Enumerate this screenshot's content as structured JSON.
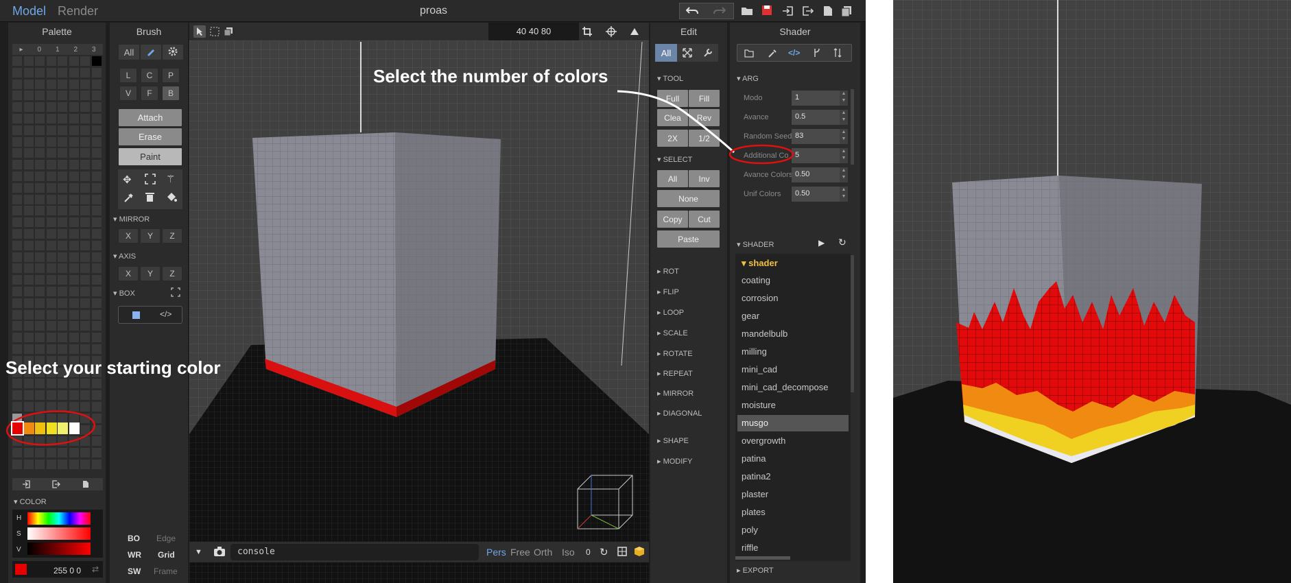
{
  "topbar": {
    "tabs": [
      "Model",
      "Render"
    ],
    "project": "proas"
  },
  "palette": {
    "title": "Palette",
    "header_cols": [
      "▸",
      "0",
      "1",
      "2",
      "3"
    ],
    "starting_colors": [
      "#e60000",
      "#f08a10",
      "#f0c010",
      "#f0e020",
      "#f0f070",
      "#ffffff"
    ]
  },
  "brush": {
    "title": "Brush",
    "all_label": "All",
    "letters_row1": [
      "L",
      "C",
      "P"
    ],
    "letters_row2": [
      "V",
      "F",
      "B"
    ],
    "modes": [
      "Attach",
      "Erase",
      "Paint"
    ],
    "mirror_label": "MIRROR",
    "axis_label": "AXIS",
    "box_label": "BOX",
    "xyz": [
      "X",
      "Y",
      "Z"
    ]
  },
  "viewport": {
    "size_readout": "40  40  80",
    "console_placeholder": "console",
    "camera_modes": [
      "Pers",
      "Free",
      "Orth",
      "Iso"
    ],
    "camera_value": "0"
  },
  "edit": {
    "title": "Edit",
    "all_label": "All",
    "tool_label": "TOOL",
    "tool_buttons": [
      "Full",
      "Fill",
      "Clea",
      "Rev",
      "2X",
      "1/2"
    ],
    "select_label": "SELECT",
    "select_buttons": [
      "All",
      "Inv",
      "None",
      "Copy",
      "Cut",
      "Paste"
    ],
    "sections": [
      "ROT",
      "FLIP",
      "LOOP",
      "SCALE",
      "ROTATE",
      "REPEAT",
      "MIRROR",
      "DIAGONAL",
      "SHAPE",
      "MODIFY"
    ]
  },
  "shader": {
    "title": "Shader",
    "arg_label": "ARG",
    "args": [
      {
        "label": "Modo",
        "value": "1"
      },
      {
        "label": "Avance",
        "value": "0.5"
      },
      {
        "label": "Random Seed",
        "value": "83"
      },
      {
        "label": "Additional Co",
        "value": "5"
      },
      {
        "label": "Avance Colors",
        "value": "0.50"
      },
      {
        "label": "Unif Colors",
        "value": "0.50"
      }
    ],
    "shader_label": "SHADER",
    "folder": "shader",
    "items": [
      "coating",
      "corrosion",
      "gear",
      "mandelbulb",
      "milling",
      "mini_cad",
      "mini_cad_decompose",
      "moisture",
      "musgo",
      "overgrowth",
      "patina",
      "patina2",
      "plaster",
      "plates",
      "poly",
      "riffle"
    ],
    "selected": "musgo",
    "export_label": "EXPORT"
  },
  "color": {
    "section_label": "COLOR",
    "h": "H",
    "s": "S",
    "v": "V",
    "rgb": "255  0  0",
    "current": "#e60000"
  },
  "bottom_left": {
    "rows": [
      {
        "key": "BO",
        "val": "Edge"
      },
      {
        "key": "WR",
        "val": "Grid"
      },
      {
        "key": "SW",
        "val": "Frame"
      }
    ]
  },
  "annotations": {
    "colors_count": "Select the number of colors",
    "starting_color": "Select your starting color"
  },
  "accent": "#6fa8e8"
}
